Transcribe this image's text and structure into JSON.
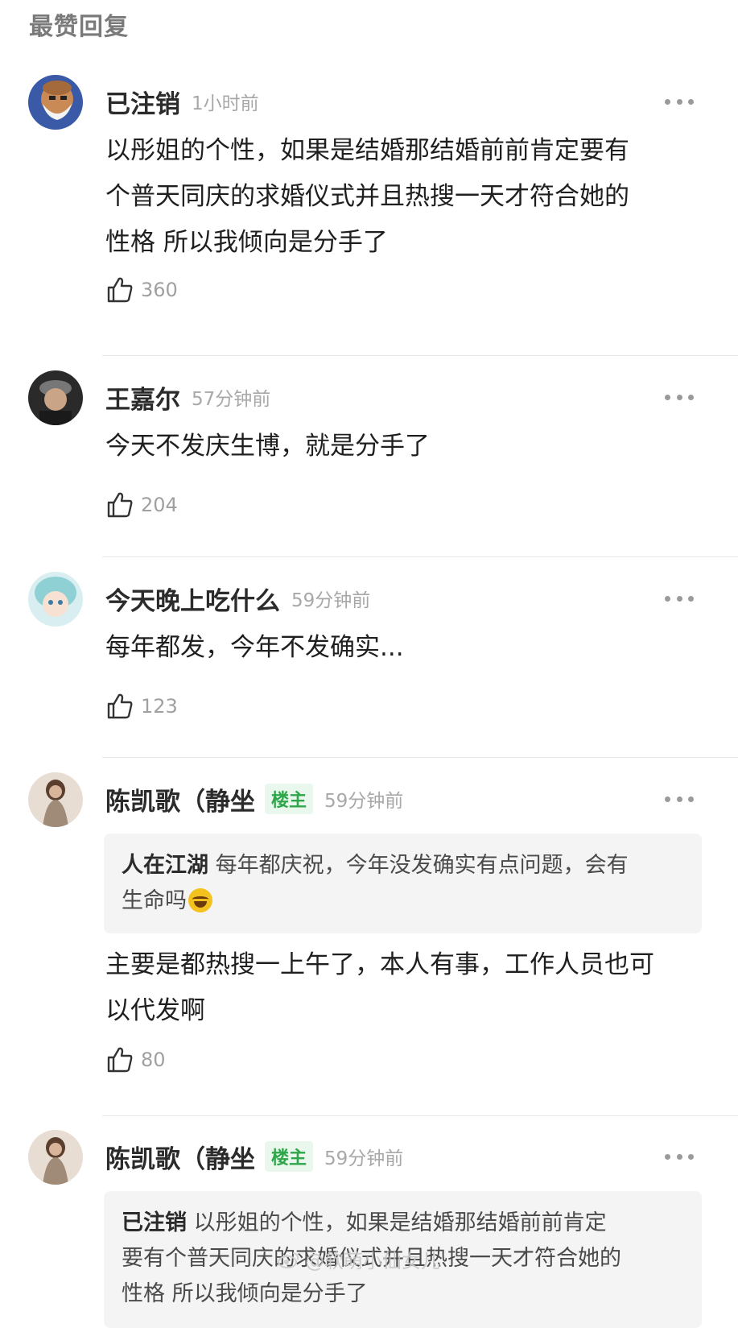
{
  "section_title": "最赞回复",
  "comments": [
    {
      "username": "已注销",
      "time": "1小时前",
      "content": [
        "以彤姐的个性，如果是结婚那结婚前前肯定要有",
        "个普天同庆的求婚仪式并且热搜一天才符合她的",
        "性格 所以我倾向是分手了"
      ],
      "likes": "360"
    },
    {
      "username": "王嘉尔",
      "time": "57分钟前",
      "content": [
        "今天不发庆生博，就是分手了"
      ],
      "likes": "204"
    },
    {
      "username": "今天晚上吃什么",
      "time": "59分钟前",
      "content": [
        "每年都发，今年不发确实..."
      ],
      "likes": "123"
    },
    {
      "username": "陈凯歌（静坐",
      "badge": "楼主",
      "time": "59分钟前",
      "quote_name": "人在江湖",
      "quote_text": [
        "每年都庆祝，今年没发确实有点问题，会有",
        "生命吗"
      ],
      "quote_emoji": "laugh-cry-emoji",
      "content": [
        "主要是都热搜一上午了，本人有事，工作人员也可",
        "以代发啊"
      ],
      "likes": "80"
    },
    {
      "username": "陈凯歌（静坐",
      "badge": "楼主",
      "time": "59分钟前",
      "quote_name": "已注销",
      "quote_text": [
        "以彤姐的个性，如果是结婚那结婚前前肯定",
        "要有个普天同庆的求婚仪式并且热搜一天才符合她的",
        "性格 所以我倾向是分手了"
      ]
    }
  ],
  "watermark": "@软萌小仙女儿",
  "colors": {
    "badge_bg": "#e9f7ec",
    "badge_text": "#2fa64a",
    "quote_bg": "#f4f4f4",
    "muted": "#a8a8a8"
  }
}
